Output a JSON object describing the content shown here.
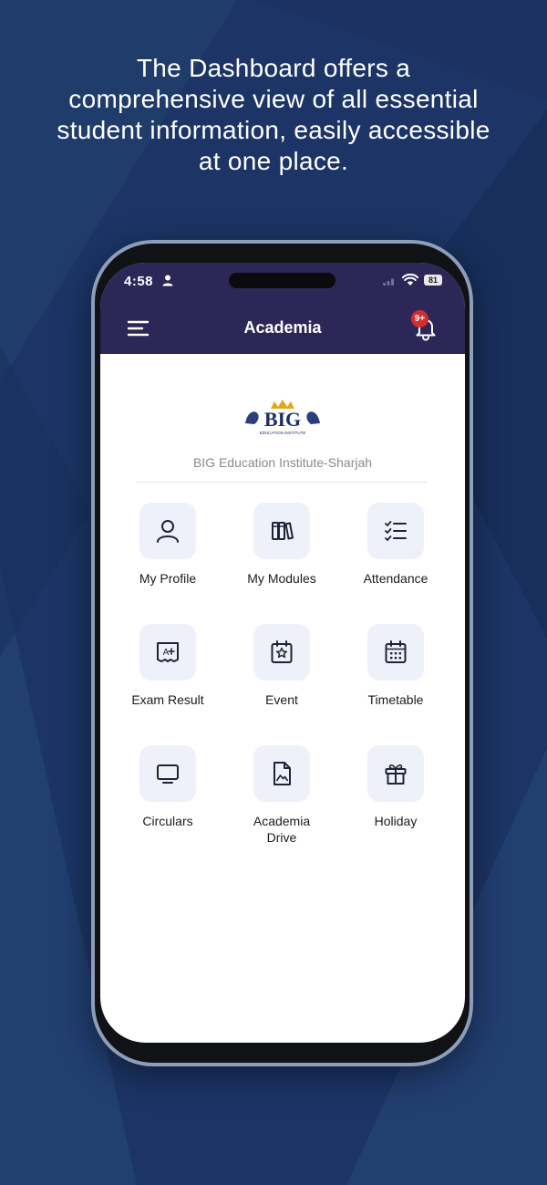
{
  "headline": {
    "lines": [
      "The Dashboard offers a",
      "comprehensive view of all essential",
      "student information, easily accessible",
      "at one place."
    ]
  },
  "status_bar": {
    "time": "4:58",
    "battery": "81"
  },
  "app_bar": {
    "title": "Academia",
    "notification_badge": "9+",
    "menu_icon": "hamburger-menu-icon",
    "bell_icon": "bell-icon"
  },
  "institute": {
    "logo_text": "BIG",
    "logo_subtext": "EDUCATION INSTITUTE",
    "name": "BIG Education Institute-Sharjah"
  },
  "modules": [
    {
      "label": "My Profile",
      "icon": "user-icon"
    },
    {
      "label": "My Modules",
      "icon": "books-icon"
    },
    {
      "label": "Attendance",
      "icon": "checklist-icon"
    },
    {
      "label": "Exam Result",
      "icon": "grade-icon"
    },
    {
      "label": "Event",
      "icon": "calendar-star-icon"
    },
    {
      "label": "Timetable",
      "icon": "calendar-icon"
    },
    {
      "label": "Circulars",
      "icon": "monitor-icon"
    },
    {
      "label": "Academia Drive",
      "icon": "document-image-icon"
    },
    {
      "label": "Holiday",
      "icon": "gift-icon"
    }
  ],
  "colors": {
    "background": "#1c3566",
    "app_bar": "#2c2757",
    "tile_background": "#eef0fa",
    "badge": "#d62c2c",
    "icon_stroke": "#1f2336"
  }
}
